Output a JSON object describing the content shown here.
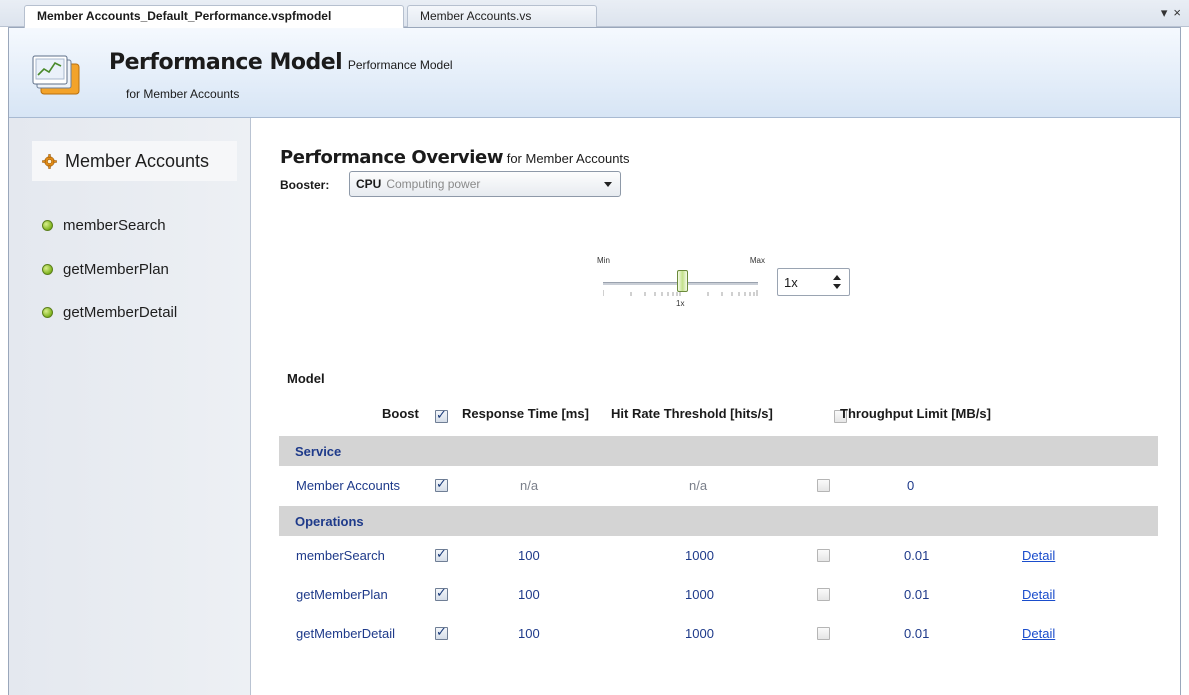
{
  "tabs": [
    {
      "label": "Member Accounts_Default_Performance.vspfmodel",
      "active": true
    },
    {
      "label": "Member Accounts.vs",
      "active": false
    }
  ],
  "window_controls": {
    "dropdown": "▾",
    "close": "×"
  },
  "header": {
    "title": "Performance Model",
    "title_suffix": "Performance Model",
    "subtitle": "for Member Accounts",
    "icon": "performance-chart-icon"
  },
  "sidebar": {
    "root": {
      "label": "Member Accounts",
      "icon": "gear-icon"
    },
    "items": [
      {
        "label": "memberSearch",
        "icon": "green-dot-icon"
      },
      {
        "label": "getMemberPlan",
        "icon": "green-dot-icon"
      },
      {
        "label": "getMemberDetail",
        "icon": "green-dot-icon"
      }
    ]
  },
  "overview": {
    "title": "Performance Overview",
    "title_suffix": "for Member Accounts",
    "booster_label": "Booster:",
    "booster_value": "CPU",
    "booster_description": "Computing power",
    "slider": {
      "min_label": "Min",
      "max_label": "Max",
      "tick_label": "1x",
      "value": "1x"
    }
  },
  "model": {
    "label": "Model",
    "headers": {
      "boost": "Boost",
      "response_time": "Response Time [ms]",
      "hit_rate": "Hit Rate Threshold [hits/s]",
      "throughput": "Throughput Limit [MB/s]"
    },
    "service_section": "Service",
    "service_row": {
      "name": "Member Accounts",
      "boost": true,
      "response_time": "n/a",
      "hit_rate": "n/a",
      "throughput_checked": false,
      "throughput": "0"
    },
    "operations_section": "Operations",
    "operations": [
      {
        "name": "memberSearch",
        "boost": true,
        "response_time": "100",
        "hit_rate": "1000",
        "throughput_checked": false,
        "throughput": "0.01",
        "detail": "Detail"
      },
      {
        "name": "getMemberPlan",
        "boost": true,
        "response_time": "100",
        "hit_rate": "1000",
        "throughput_checked": false,
        "throughput": "0.01",
        "detail": "Detail"
      },
      {
        "name": "getMemberDetail",
        "boost": true,
        "response_time": "100",
        "hit_rate": "1000",
        "throughput_checked": false,
        "throughput": "0.01",
        "detail": "Detail"
      }
    ]
  },
  "colors": {
    "link": "#1a4dcc",
    "row_text": "#1e3a8a",
    "section_bg": "#d4d4d4",
    "header_bg": "#d7e5f5"
  }
}
